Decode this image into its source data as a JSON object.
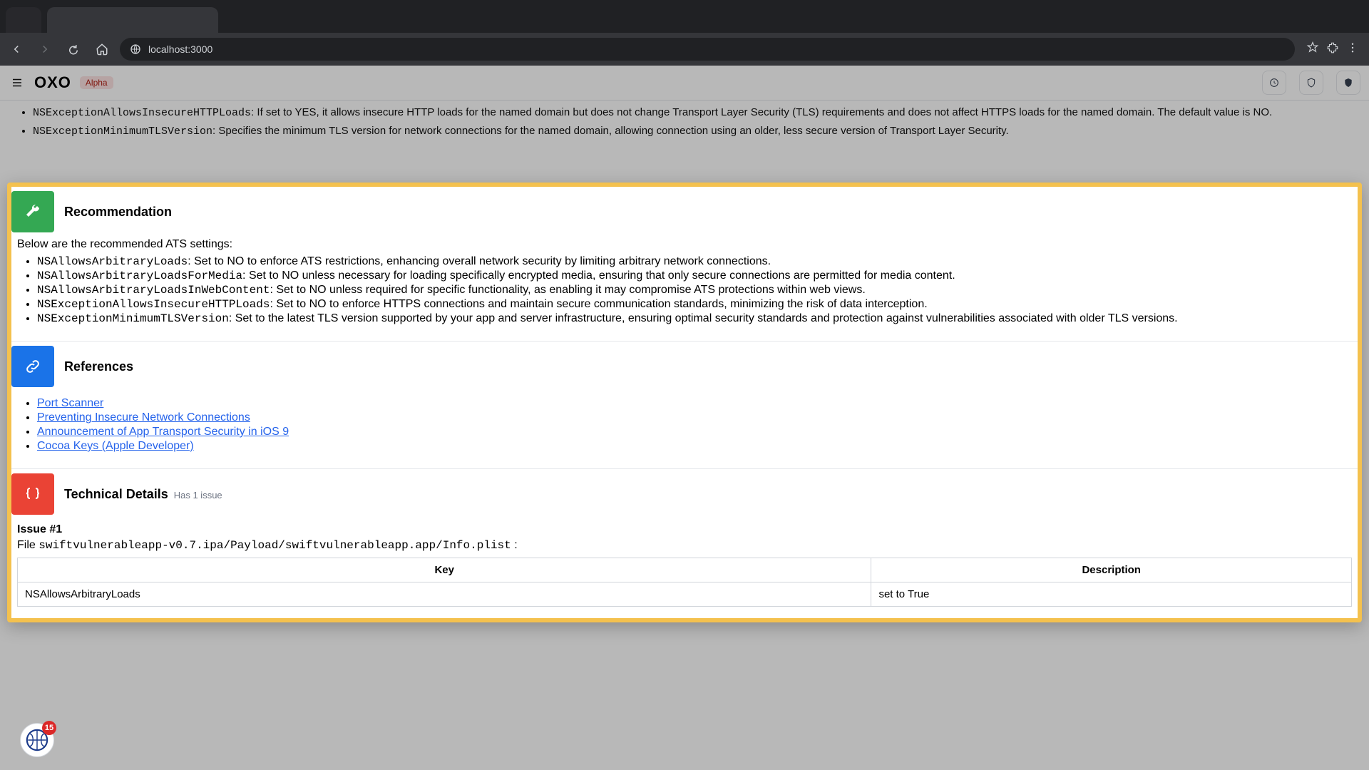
{
  "browser": {
    "url": "localhost:3000"
  },
  "header": {
    "logo": "OXO",
    "badge": "Alpha"
  },
  "pre_modal": {
    "exception_loads": {
      "code": "NSExceptionAllowsInsecureHTTPLoads",
      "text": ": If set to YES, it allows insecure HTTP loads for the named domain but does not change Transport Layer Security (TLS) requirements and does not affect HTTPS loads for the named domain. The default value is NO."
    },
    "min_tls": {
      "code": "NSExceptionMinimumTLSVersion",
      "text": ": Specifies the minimum TLS version for network connections for the named domain, allowing connection using an older, less secure version of Transport Layer Security."
    }
  },
  "recommendation": {
    "title": "Recommendation",
    "intro": "Below are the recommended ATS settings:",
    "items": [
      {
        "code": "NSAllowsArbitraryLoads",
        "text": ": Set to NO to enforce ATS restrictions, enhancing overall network security by limiting arbitrary network connections."
      },
      {
        "code": "NSAllowsArbitraryLoadsForMedia",
        "text": ": Set to NO unless necessary for loading specifically encrypted media, ensuring that only secure connections are permitted for media content."
      },
      {
        "code": "NSAllowsArbitraryLoadsInWebContent",
        "text": ": Set to NO unless required for specific functionality, as enabling it may compromise ATS protections within web views."
      },
      {
        "code": "NSExceptionAllowsInsecureHTTPLoads",
        "text": ": Set to NO to enforce HTTPS connections and maintain secure communication standards, minimizing the risk of data interception."
      },
      {
        "code": "NSExceptionMinimumTLSVersion",
        "text": ": Set to the latest TLS version supported by your app and server infrastructure, ensuring optimal security standards and protection against vulnerabilities associated with older TLS versions."
      }
    ]
  },
  "references": {
    "title": "References",
    "links": [
      "Port Scanner",
      "Preventing Insecure Network Connections",
      "Announcement of App Transport Security in iOS 9",
      "Cocoa Keys (Apple Developer)"
    ]
  },
  "technical": {
    "title": "Technical Details",
    "subtitle": "Has 1 issue",
    "issue_label": "Issue #1",
    "file_prefix": "File ",
    "file_path": "swiftvulnerableapp-v0.7.ipa/Payload/swiftvulnerableapp.app/Info.plist",
    "file_suffix": " :",
    "table": {
      "headers": {
        "key": "Key",
        "desc": "Description"
      },
      "rows": [
        {
          "key": "NSAllowsArbitraryLoads",
          "desc": "set to True"
        }
      ]
    }
  },
  "float": {
    "count": "15"
  }
}
